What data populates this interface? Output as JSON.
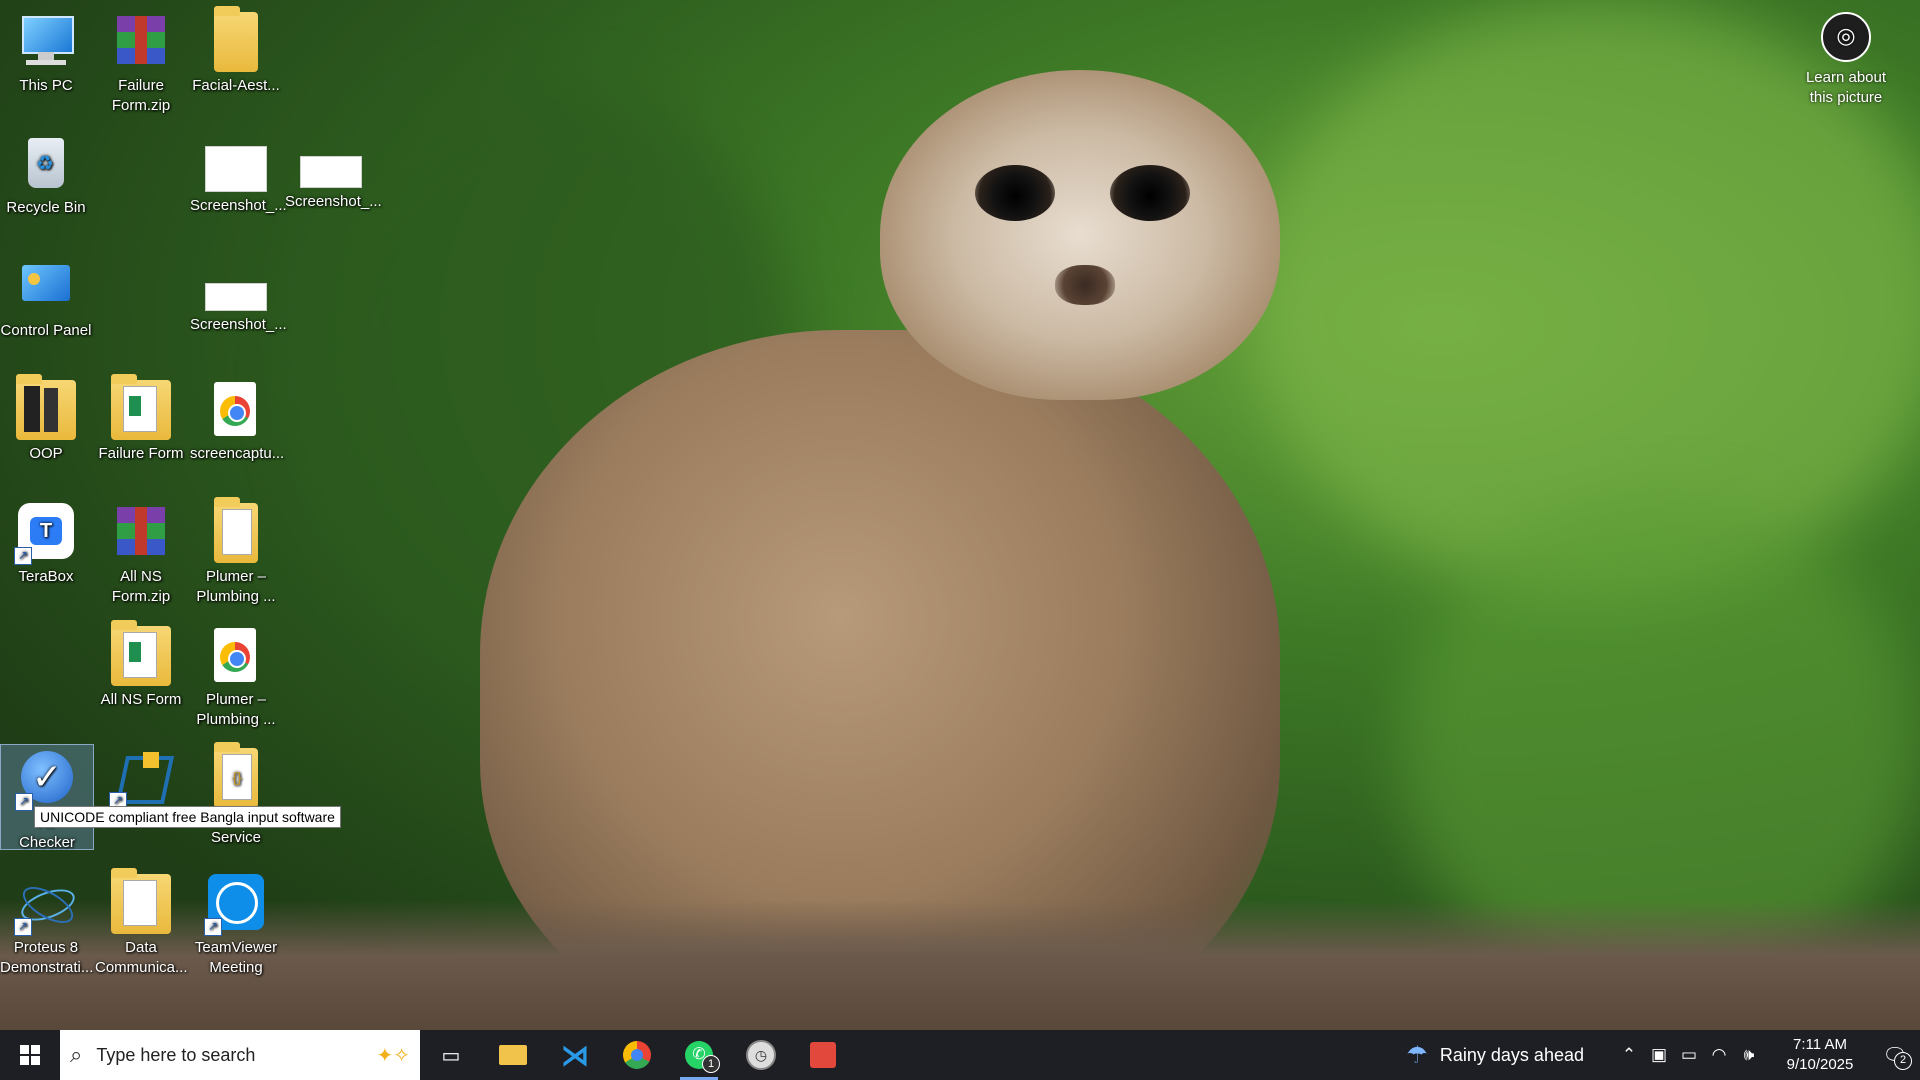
{
  "desktop": {
    "icons": {
      "this_pc": "This PC",
      "failure_form_zip": "Failure\nForm.zip",
      "facial_aest": "Facial-Aest...",
      "recycle_bin": "Recycle Bin",
      "screenshot1": "Screenshot_...",
      "screenshot2": "Screenshot_...",
      "control_panel": "Control Panel",
      "screenshot3": "Screenshot_...",
      "oop": "OOP",
      "failure_form": "Failure Form",
      "screencaptu": "screencaptu...",
      "terabox": "TeraBox",
      "all_ns_form_zip": "All NS\nForm.zip",
      "plumer1": "Plumer –\nPlumbing ...",
      "all_ns_form": "All NS Form",
      "plumer2": "Plumer –\nPlumbing ...",
      "avro_checker": "Av\nChecker",
      "virtualbox": "VirtualBox",
      "service": "Service",
      "proteus": "Proteus 8\nDemonstrati...",
      "data_comm": "Data\nCommunica...",
      "teamviewer": "TeamViewer\nMeeting"
    },
    "tooltip": "UNICODE compliant free Bangla input software",
    "learn_about": "Learn about\nthis picture"
  },
  "taskbar": {
    "search_placeholder": "Type here to search",
    "whatsapp_badge": "1",
    "weather": "Rainy days ahead",
    "time": "7:11 AM",
    "date": "9/10/2025",
    "notification_count": "2"
  }
}
